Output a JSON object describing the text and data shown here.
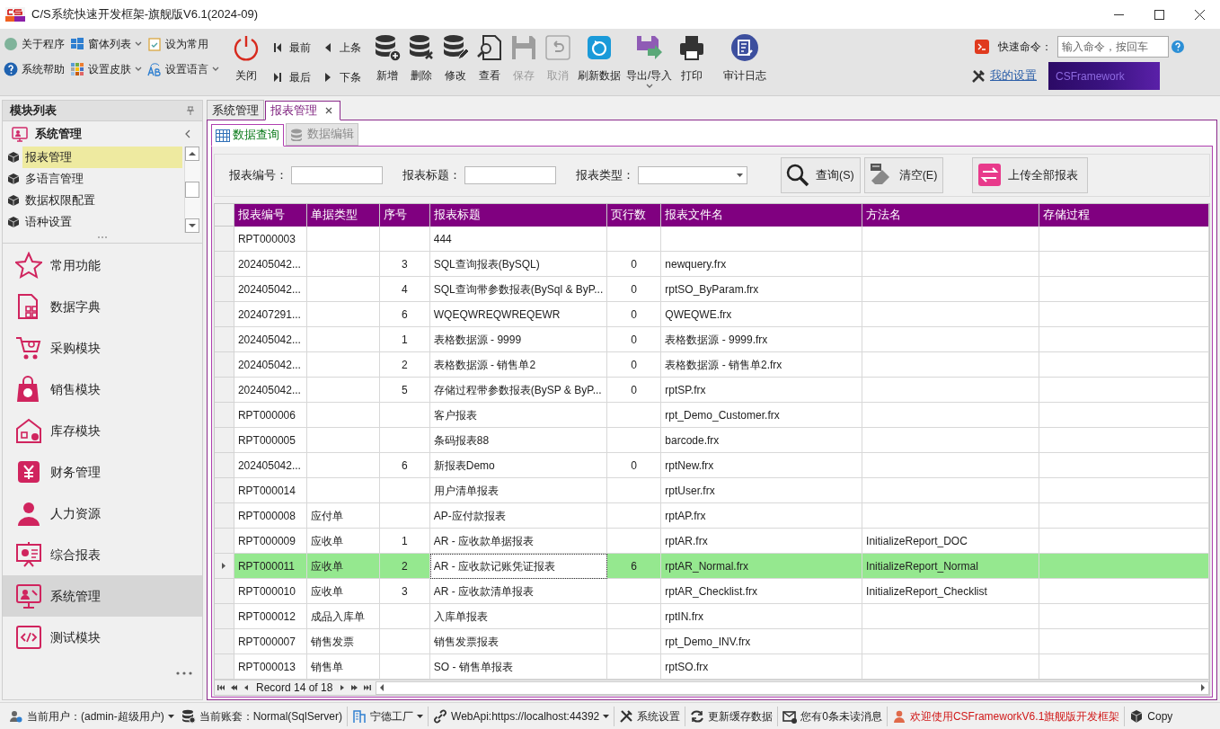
{
  "window": {
    "title": "C/S系统快速开发框架-旗舰版V6.1(2024-09)"
  },
  "toolbar": {
    "small_items": [
      {
        "label": "关于程序",
        "dropdown": false
      },
      {
        "label": "窗体列表",
        "dropdown": true
      },
      {
        "label": "设为常用",
        "dropdown": false
      },
      {
        "label": "系统帮助",
        "dropdown": false
      },
      {
        "label": "设置皮肤",
        "dropdown": true
      },
      {
        "label": "设置语言",
        "dropdown": true
      }
    ],
    "close": "关闭",
    "nav": [
      "最前",
      "上条",
      "最后",
      "下条"
    ],
    "buttons": [
      {
        "label": "新增",
        "disabled": false,
        "dropdown": false
      },
      {
        "label": "删除",
        "disabled": false,
        "dropdown": false
      },
      {
        "label": "修改",
        "disabled": false,
        "dropdown": false
      },
      {
        "label": "查看",
        "disabled": false,
        "dropdown": false
      },
      {
        "label": "保存",
        "disabled": true,
        "dropdown": false
      },
      {
        "label": "取消",
        "disabled": true,
        "dropdown": false
      },
      {
        "label": "刷新数据",
        "disabled": false,
        "dropdown": false
      },
      {
        "label": "导出/导入",
        "disabled": false,
        "dropdown": true
      },
      {
        "label": "打印",
        "disabled": false,
        "dropdown": false
      },
      {
        "label": "审计日志",
        "disabled": false,
        "dropdown": false
      }
    ],
    "quick_command": {
      "label": "快速命令：",
      "placeholder": "输入命令，按回车"
    },
    "my_settings": "我的设置",
    "banner": "CSFramework"
  },
  "sidebar": {
    "title": "模块列表",
    "group": "系统管理",
    "items": [
      {
        "label": "报表管理",
        "selected": true
      },
      {
        "label": "多语言管理",
        "selected": false
      },
      {
        "label": "数据权限配置",
        "selected": false
      },
      {
        "label": "语种设置",
        "selected": false
      }
    ],
    "modules": [
      {
        "label": "常用功能",
        "selected": false
      },
      {
        "label": "数据字典",
        "selected": false
      },
      {
        "label": "采购模块",
        "selected": false
      },
      {
        "label": "销售模块",
        "selected": false
      },
      {
        "label": "库存模块",
        "selected": false
      },
      {
        "label": "财务管理",
        "selected": false
      },
      {
        "label": "人力资源",
        "selected": false
      },
      {
        "label": "综合报表",
        "selected": false
      },
      {
        "label": "系统管理",
        "selected": true
      },
      {
        "label": "测试模块",
        "selected": false
      }
    ]
  },
  "tabs": [
    {
      "label": "系统管理",
      "selected": false,
      "closable": false
    },
    {
      "label": "报表管理",
      "selected": true,
      "closable": true
    }
  ],
  "inner_tabs": [
    {
      "label": "数据查询",
      "selected": true
    },
    {
      "label": "数据编辑",
      "selected": false
    }
  ],
  "filters": [
    {
      "label": "报表编号：",
      "kind": "text"
    },
    {
      "label": "报表标题：",
      "kind": "text"
    },
    {
      "label": "报表类型：",
      "kind": "select"
    }
  ],
  "actions": [
    "查询(S)",
    "清空(E)",
    "上传全部报表"
  ],
  "table": {
    "columns": [
      "报表编号",
      "单据类型",
      "序号",
      "报表标题",
      "页行数",
      "报表文件名",
      "方法名",
      "存储过程"
    ],
    "rows": [
      {
        "selected": false,
        "cells": [
          "RPT000003",
          "",
          "",
          "444",
          "",
          "",
          "",
          ""
        ]
      },
      {
        "selected": false,
        "cells": [
          "202405042...",
          "",
          "3",
          "SQL查询报表(BySQL)",
          "0",
          "newquery.frx",
          "",
          ""
        ]
      },
      {
        "selected": false,
        "cells": [
          "202405042...",
          "",
          "4",
          "SQL查询带参数报表(BySql & ByP...",
          "0",
          "rptSO_ByParam.frx",
          "",
          ""
        ]
      },
      {
        "selected": false,
        "cells": [
          "202407291...",
          "",
          "6",
          "WQEQWREQWREQEWR",
          "0",
          "QWEQWE.frx",
          "",
          ""
        ]
      },
      {
        "selected": false,
        "cells": [
          "202405042...",
          "",
          "1",
          "表格数据源 - 9999",
          "0",
          "表格数据源 - 9999.frx",
          "",
          ""
        ]
      },
      {
        "selected": false,
        "cells": [
          "202405042...",
          "",
          "2",
          "表格数据源 - 销售单2",
          "0",
          "表格数据源 - 销售单2.frx",
          "",
          ""
        ]
      },
      {
        "selected": false,
        "cells": [
          "202405042...",
          "",
          "5",
          "存储过程带参数报表(BySP & ByP...",
          "0",
          "rptSP.frx",
          "",
          ""
        ]
      },
      {
        "selected": false,
        "cells": [
          "RPT000006",
          "",
          "",
          "客户报表",
          "",
          "rpt_Demo_Customer.frx",
          "",
          ""
        ]
      },
      {
        "selected": false,
        "cells": [
          "RPT000005",
          "",
          "",
          "条码报表88",
          "",
          "barcode.frx",
          "",
          ""
        ]
      },
      {
        "selected": false,
        "cells": [
          "202405042...",
          "",
          "6",
          "新报表Demo",
          "0",
          "rptNew.frx",
          "",
          ""
        ]
      },
      {
        "selected": false,
        "cells": [
          "RPT000014",
          "",
          "",
          "用户清单报表",
          "",
          "rptUser.frx",
          "",
          ""
        ]
      },
      {
        "selected": false,
        "cells": [
          "RPT000008",
          "应付单",
          "",
          "AP-应付款报表",
          "",
          "rptAP.frx",
          "",
          ""
        ]
      },
      {
        "selected": false,
        "cells": [
          "RPT000009",
          "应收单",
          "1",
          "AR - 应收款单据报表",
          "",
          "rptAR.frx",
          "InitializeReport_DOC",
          ""
        ]
      },
      {
        "selected": true,
        "cells": [
          "RPT000011",
          "应收单",
          "2",
          "AR - 应收款记账凭证报表",
          "6",
          "rptAR_Normal.frx",
          "InitializeReport_Normal",
          ""
        ]
      },
      {
        "selected": false,
        "cells": [
          "RPT000010",
          "应收单",
          "3",
          "AR - 应收款清单报表",
          "",
          "rptAR_Checklist.frx",
          "InitializeReport_Checklist",
          ""
        ]
      },
      {
        "selected": false,
        "cells": [
          "RPT000012",
          "成品入库单",
          "",
          "入库单报表",
          "",
          "rptIN.frx",
          "",
          ""
        ]
      },
      {
        "selected": false,
        "cells": [
          "RPT000007",
          "销售发票",
          "",
          "销售发票报表",
          "",
          "rpt_Demo_INV.frx",
          "",
          ""
        ]
      },
      {
        "selected": false,
        "cells": [
          "RPT000013",
          "销售单",
          "",
          "SO - 销售单报表",
          "",
          "rptSO.frx",
          "",
          ""
        ]
      }
    ],
    "pager": "Record 14 of 18"
  },
  "status_bar": [
    {
      "text": "当前用户：(admin-超级用户)",
      "dropdown": true,
      "highlight": false
    },
    {
      "text": "当前账套：Normal(SqlServer)",
      "dropdown": false,
      "highlight": false
    },
    {
      "text": "宁德工厂",
      "dropdown": true,
      "highlight": false
    },
    {
      "text": "WebApi:https://localhost:44392",
      "dropdown": true,
      "highlight": false
    },
    {
      "text": "系统设置",
      "dropdown": false,
      "highlight": false
    },
    {
      "text": "更新缓存数据",
      "dropdown": false,
      "highlight": false
    },
    {
      "text": "您有0条未读消息",
      "dropdown": false,
      "highlight": false
    },
    {
      "text": "欢迎使用CSFrameworkV6.1旗舰版开发框架",
      "dropdown": false,
      "highlight": true
    },
    {
      "text": "Copy",
      "dropdown": false,
      "highlight": false
    }
  ]
}
